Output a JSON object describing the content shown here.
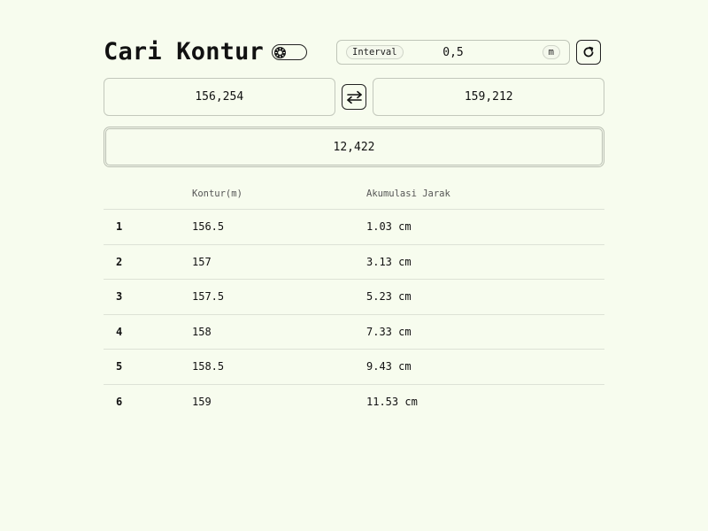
{
  "header": {
    "title": "Cari Kontur",
    "theme_icon": "sun-icon"
  },
  "interval": {
    "label": "Interval",
    "value": "0,5",
    "unit": "m"
  },
  "reset_icon": "refresh-icon",
  "inputs": {
    "start_value": "156,254",
    "end_value": "159,212",
    "swap_icon": "swap-arrows-icon"
  },
  "result": {
    "value": "12,422"
  },
  "table": {
    "headers": [
      "",
      "Kontur(m)",
      "Akumulasi Jarak"
    ],
    "rows": [
      {
        "no": "1",
        "kontur": "156.5",
        "jarak": "1.03 cm"
      },
      {
        "no": "2",
        "kontur": "157",
        "jarak": "3.13 cm"
      },
      {
        "no": "3",
        "kontur": "157.5",
        "jarak": "5.23 cm"
      },
      {
        "no": "4",
        "kontur": "158",
        "jarak": "7.33 cm"
      },
      {
        "no": "5",
        "kontur": "158.5",
        "jarak": "9.43 cm"
      },
      {
        "no": "6",
        "kontur": "159",
        "jarak": "11.53 cm"
      }
    ]
  }
}
